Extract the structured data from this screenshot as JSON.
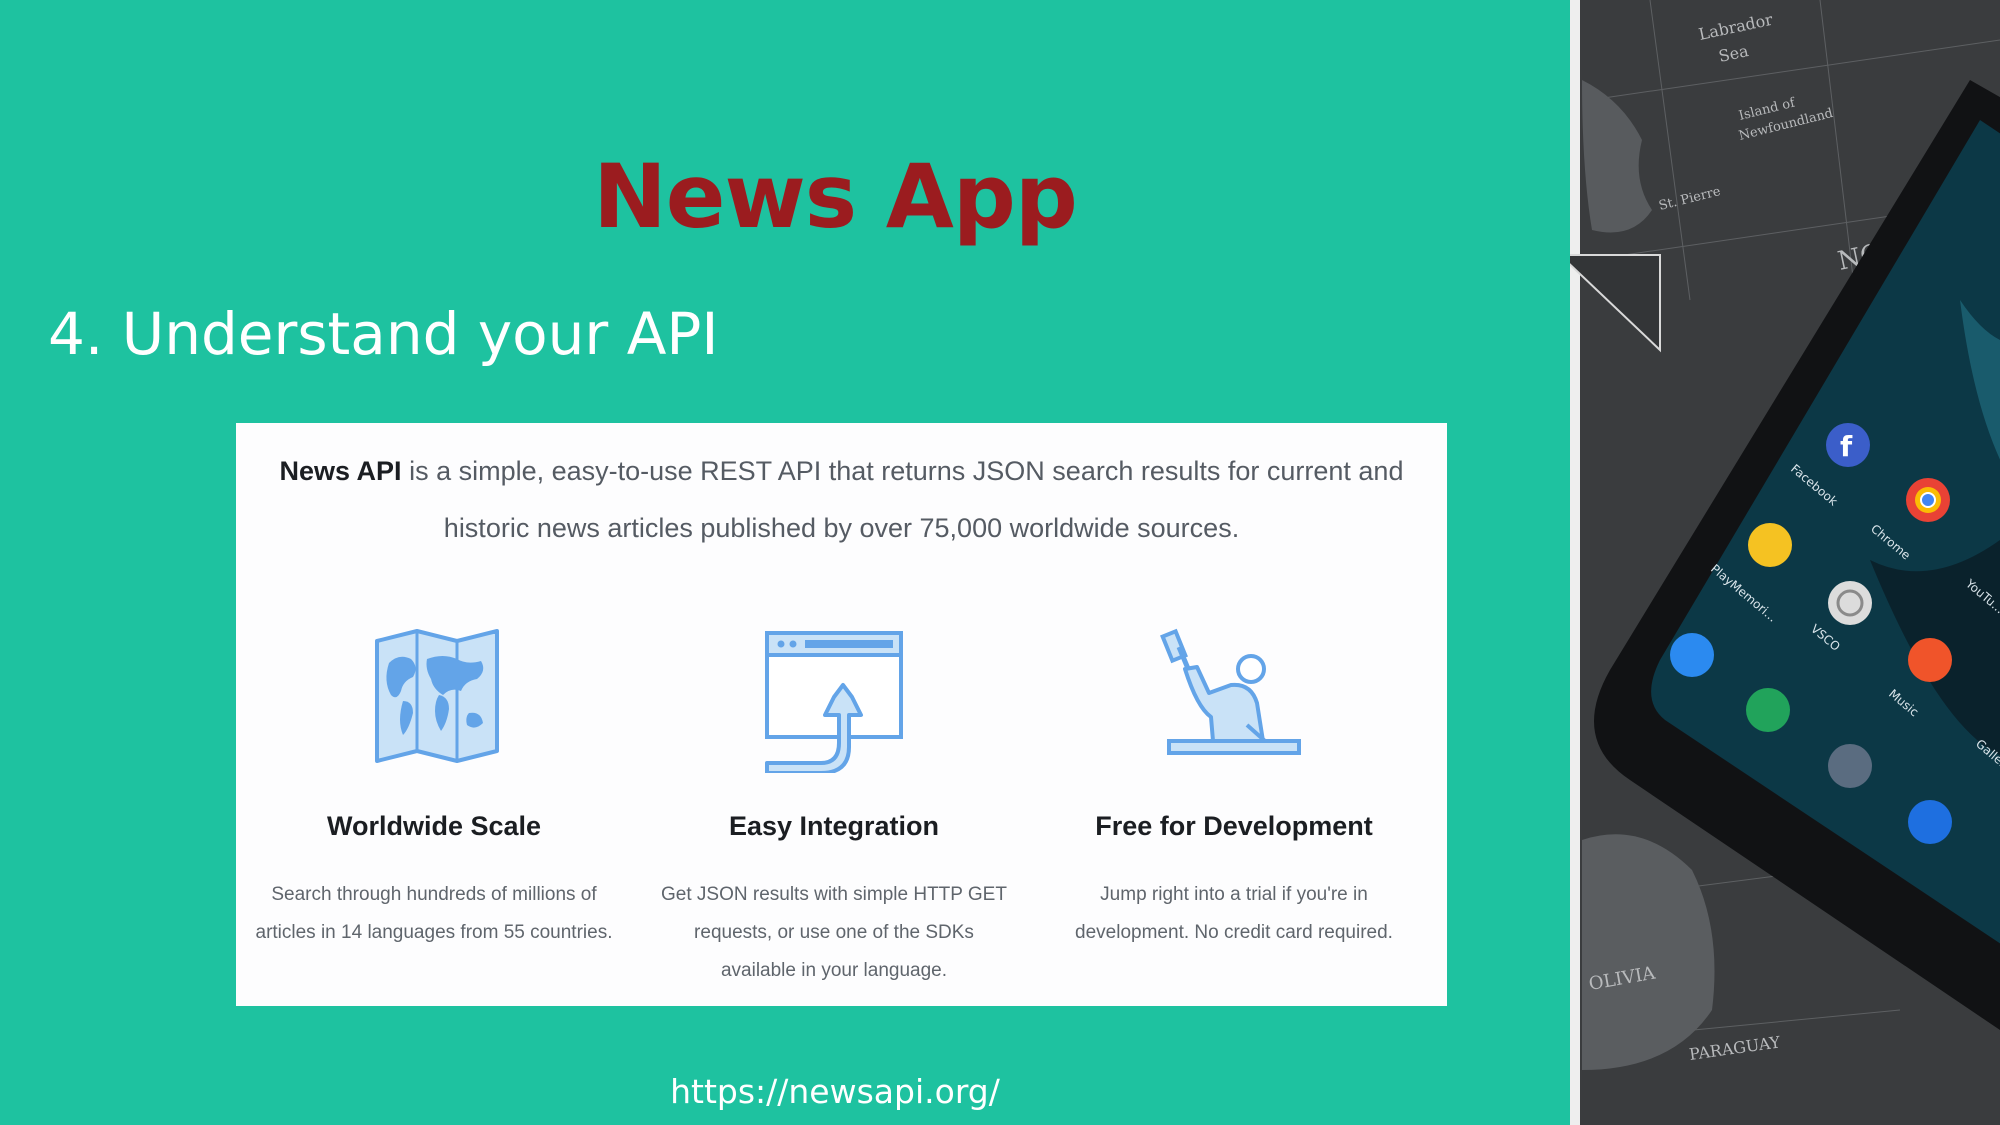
{
  "slide": {
    "title": "News App",
    "subtitle": "4. Understand your API",
    "url": "https://newsapi.org/"
  },
  "card": {
    "intro_strong": "News API",
    "intro_rest": " is a simple, easy-to-use REST API that returns JSON search results for current and historic news articles published by over 75,000 worldwide sources.",
    "features": [
      {
        "title": "Worldwide Scale",
        "desc": "Search through hundreds of millions of articles in 14 languages from 55 countries.",
        "icon": "world-map-icon"
      },
      {
        "title": "Easy Integration",
        "desc": "Get JSON results with simple HTTP GET requests, or use one of the SDKs available in your language.",
        "icon": "browser-upload-icon"
      },
      {
        "title": "Free for Development",
        "desc": "Jump right into a trial if you're in development. No credit card required.",
        "icon": "developer-hammer-icon"
      }
    ]
  },
  "photo": {
    "description_icon": "phone-on-map-icon",
    "map_labels": [
      "Labrador Sea",
      "Island of Newfoundland",
      "St. Pierre",
      "NO",
      "OLIVIA",
      "PARAGUAY"
    ],
    "app_labels": [
      "Facebook",
      "Chrome",
      "PlayMemori...",
      "VSCO",
      "YouTu...",
      "Music",
      "Gallery"
    ],
    "colors": {
      "background": "#1ec2a0",
      "title": "#9b1c1f",
      "icon_blue": "#63a4e8",
      "icon_fill": "#c9e2f7"
    }
  }
}
